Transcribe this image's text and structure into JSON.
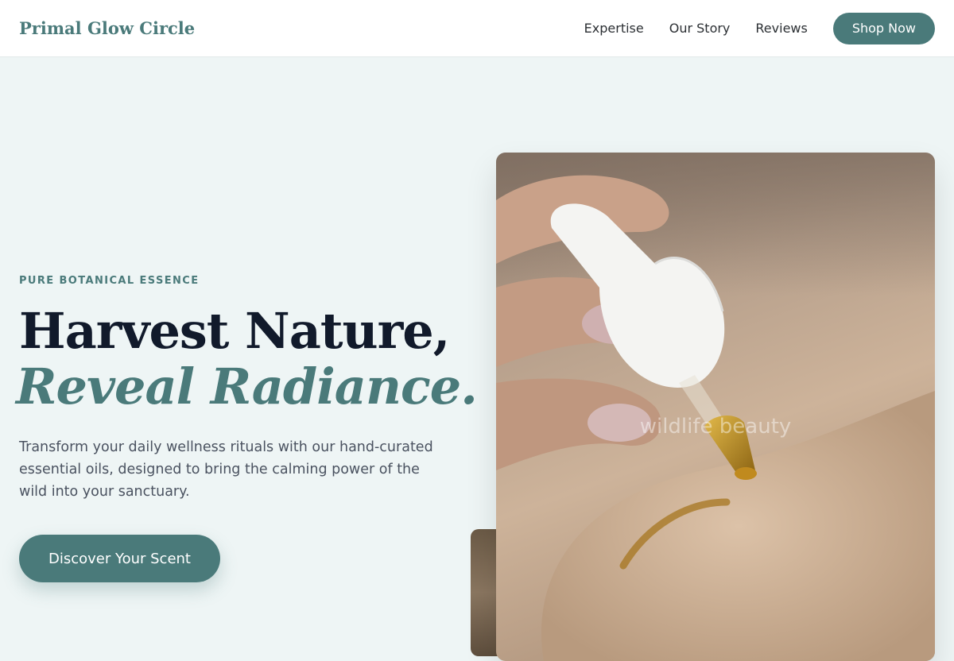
{
  "header": {
    "brand": "Primal Glow Circle",
    "nav": [
      {
        "label": "Expertise"
      },
      {
        "label": "Our Story"
      },
      {
        "label": "Reviews"
      }
    ],
    "cta_label": "Shop Now"
  },
  "hero": {
    "eyebrow": "PURE BOTANICAL ESSENCE",
    "headline_line1": "Harvest Nature,",
    "headline_line2": "Reveal Radiance.",
    "description": "Transform your daily wellness rituals with our hand-curated essential oils, designed to bring the calming power of the wild into your sanctuary.",
    "cta_label": "Discover Your Scent",
    "image_caption": "wildlife beauty"
  },
  "colors": {
    "accent": "#4a7a7a",
    "headline": "#111a2b",
    "background": "#eef5f5",
    "body_text": "#4a5260"
  }
}
